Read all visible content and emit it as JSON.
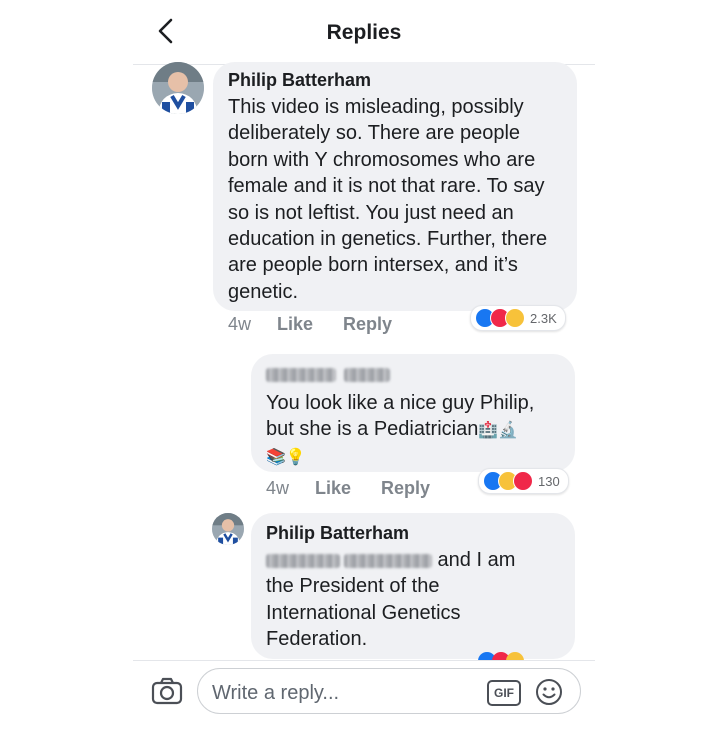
{
  "header": {
    "title": "Replies"
  },
  "comments": [
    {
      "author": "Philip Batterham",
      "text": "This video is misleading, possibly\ndeliberately so.  There are people\nborn with Y chromosomes who are\nfemale and it is not that rare. To say\nso is not leftist.  You just need an\neducation in genetics.  Further, there\nare people born intersex, and it’s\ngenetic.",
      "time": "4w",
      "like": "Like",
      "reply": "Reply",
      "reaction_count": "2.3K"
    },
    {
      "author_redacted": true,
      "text": "You look like a nice guy Philip,\nbut she is a Pediatrician",
      "emoji_line1": "🏥🔬",
      "emoji_line2": "📚💡",
      "time": "4w",
      "like": "Like",
      "reply": "Reply",
      "reaction_count": "130"
    },
    {
      "author": "Philip Batterham",
      "mention_redacted": true,
      "text_after_mention": " and I am",
      "text": "the President of the\nInternational Genetics\nFederation."
    }
  ],
  "composer": {
    "placeholder": "Write a reply...",
    "gif_label": "GIF"
  },
  "colors": {
    "bubble": "#f0f1f4",
    "like_blue": "#1877f2",
    "love_red": "#f02849",
    "haha_yellow": "#f7c23a"
  }
}
